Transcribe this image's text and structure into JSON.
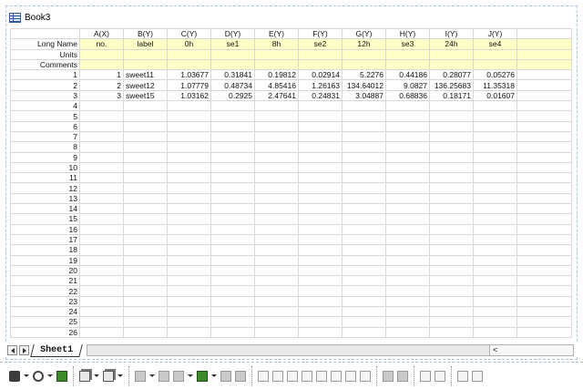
{
  "window": {
    "title": "Book3"
  },
  "columns": [
    {
      "header": "A(X)",
      "long_name": "no.",
      "units": "",
      "comments": ""
    },
    {
      "header": "B(Y)",
      "long_name": "label",
      "units": "",
      "comments": ""
    },
    {
      "header": "C(Y)",
      "long_name": "0h",
      "units": "",
      "comments": ""
    },
    {
      "header": "D(Y)",
      "long_name": "se1",
      "units": "",
      "comments": ""
    },
    {
      "header": "E(Y)",
      "long_name": "8h",
      "units": "",
      "comments": ""
    },
    {
      "header": "F(Y)",
      "long_name": "se2",
      "units": "",
      "comments": ""
    },
    {
      "header": "G(Y)",
      "long_name": "12h",
      "units": "",
      "comments": ""
    },
    {
      "header": "H(Y)",
      "long_name": "se3",
      "units": "",
      "comments": ""
    },
    {
      "header": "I(Y)",
      "long_name": "24h",
      "units": "",
      "comments": ""
    },
    {
      "header": "J(Y)",
      "long_name": "se4",
      "units": "",
      "comments": ""
    }
  ],
  "meta_labels": {
    "long_name": "Long Name",
    "units": "Units",
    "comments": "Comments"
  },
  "rows": [
    [
      "1",
      "sweet11",
      "1.03677",
      "0.31841",
      "0.19812",
      "0.02914",
      "5.2276",
      "0.44186",
      "0.28077",
      "0.05276"
    ],
    [
      "2",
      "sweet12",
      "1.07779",
      "0.48734",
      "4.85416",
      "1.26163",
      "134.64012",
      "9.0827",
      "136.25683",
      "11.35318"
    ],
    [
      "3",
      "sweet15",
      "1.03162",
      "0.2925",
      "2.47641",
      "0.24831",
      "3.04887",
      "0.68836",
      "0.18171",
      "0.01607"
    ]
  ],
  "row_count": 26,
  "sheet_tab": "Sheet1",
  "scroll_left_label": "<",
  "toolbar_icons": [
    "plot-icon",
    "bubble-icon",
    "export-icon",
    "graph-layer-icon",
    "chart-icon",
    "line-tool-icon",
    "arrange-icon",
    "scatter-tool-icon",
    "draw-icon",
    "layer-icon",
    "align-left-icon",
    "align-right-icon",
    "align-top-icon",
    "align-bottom-icon",
    "align-center-icon",
    "align-middle-icon",
    "distribute-h-icon",
    "distribute-v-icon",
    "group-icon",
    "ungroup-icon",
    "front-icon",
    "back-icon"
  ]
}
